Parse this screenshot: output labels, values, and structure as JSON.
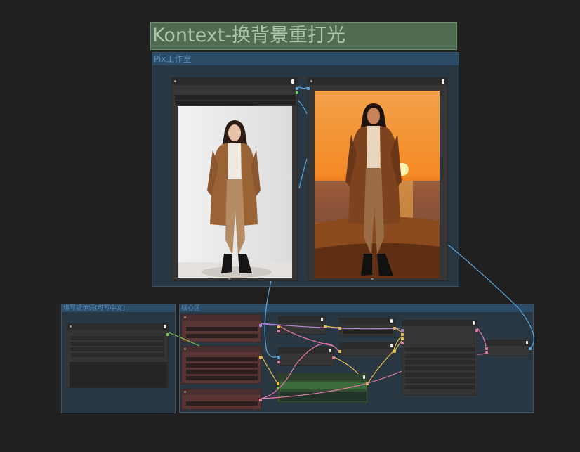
{
  "title_group": {
    "label": "Kontext-换背景重打光"
  },
  "groups": {
    "studio": {
      "label": "Pix工作室"
    },
    "prompt": {
      "label": "填写提示词(可写中文)"
    },
    "core": {
      "label": "核心区"
    }
  },
  "colors": {
    "canvas": "#202020",
    "group_blue": "#293743",
    "title_green": "#4f6b51",
    "link_blue": "#5aa7dd",
    "link_yellow": "#e8c24c",
    "link_pink": "#e47aa6",
    "link_green": "#7bc24e"
  },
  "images": {
    "input_photo": {
      "icon": "woman-in-coat-white-studio"
    },
    "output_photo": {
      "icon": "woman-in-coat-sunset-beach"
    }
  }
}
